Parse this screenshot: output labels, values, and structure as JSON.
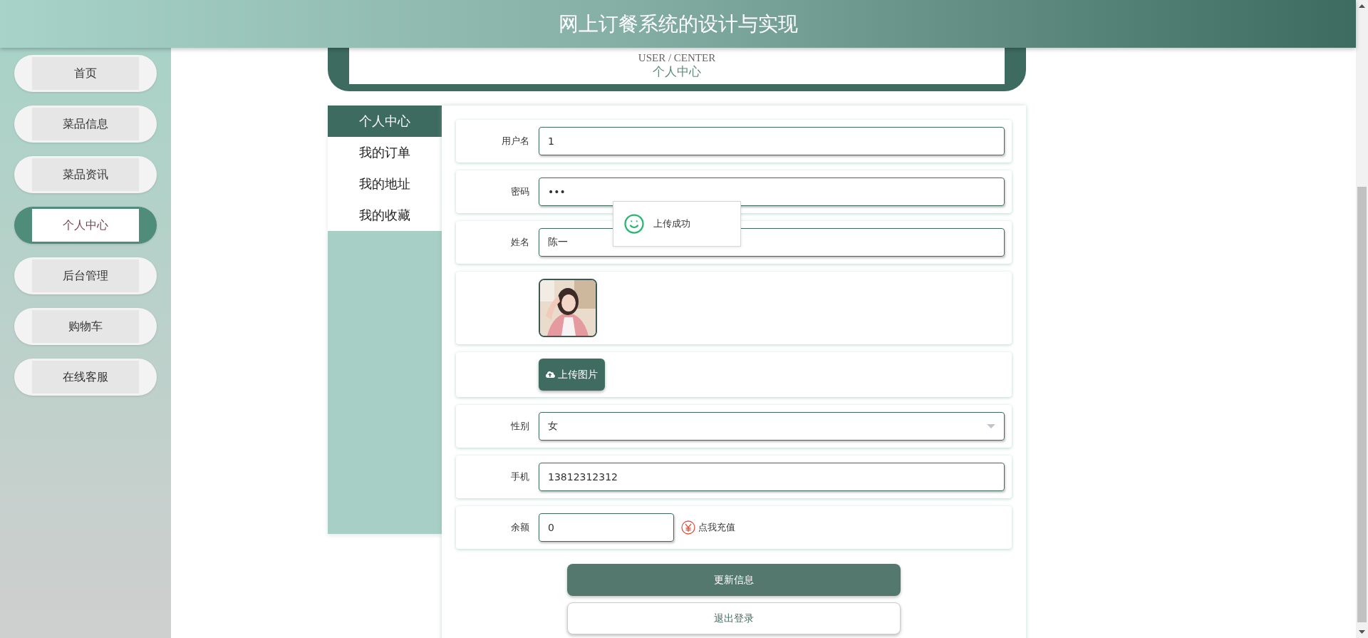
{
  "header": {
    "title": "网上订餐系统的设计与实现"
  },
  "sidebar": {
    "items": [
      {
        "label": "首页",
        "selected": false
      },
      {
        "label": "菜品信息",
        "selected": false
      },
      {
        "label": "菜品资讯",
        "selected": false
      },
      {
        "label": "个人中心",
        "selected": true
      },
      {
        "label": "后台管理",
        "selected": false
      },
      {
        "label": "购物车",
        "selected": false
      },
      {
        "label": "在线客服",
        "selected": false
      }
    ]
  },
  "banner": {
    "subtitle": "USER / CENTER",
    "title": "个人中心"
  },
  "tabs": [
    {
      "label": "个人中心",
      "selected": true
    },
    {
      "label": "我的订单",
      "selected": false
    },
    {
      "label": "我的地址",
      "selected": false
    },
    {
      "label": "我的收藏",
      "selected": false
    }
  ],
  "form": {
    "fields": [
      {
        "kind": "text",
        "label": "用户名",
        "value": "1"
      },
      {
        "kind": "text",
        "label": "密码",
        "value": "•••"
      },
      {
        "kind": "text",
        "label": "姓名",
        "value": "陈一"
      },
      {
        "kind": "avatar"
      },
      {
        "kind": "upload",
        "button": "上传图片"
      },
      {
        "kind": "select",
        "label": "性别",
        "value": "女"
      },
      {
        "kind": "text",
        "label": "手机",
        "value": "13812312312"
      },
      {
        "kind": "balance",
        "label": "余额",
        "value": "0",
        "link": "点我充值"
      }
    ],
    "buttons": [
      {
        "kind": "primary",
        "label": "更新信息"
      },
      {
        "kind": "secondary",
        "label": "退出登录"
      }
    ]
  },
  "toast": {
    "message": "上传成功"
  }
}
